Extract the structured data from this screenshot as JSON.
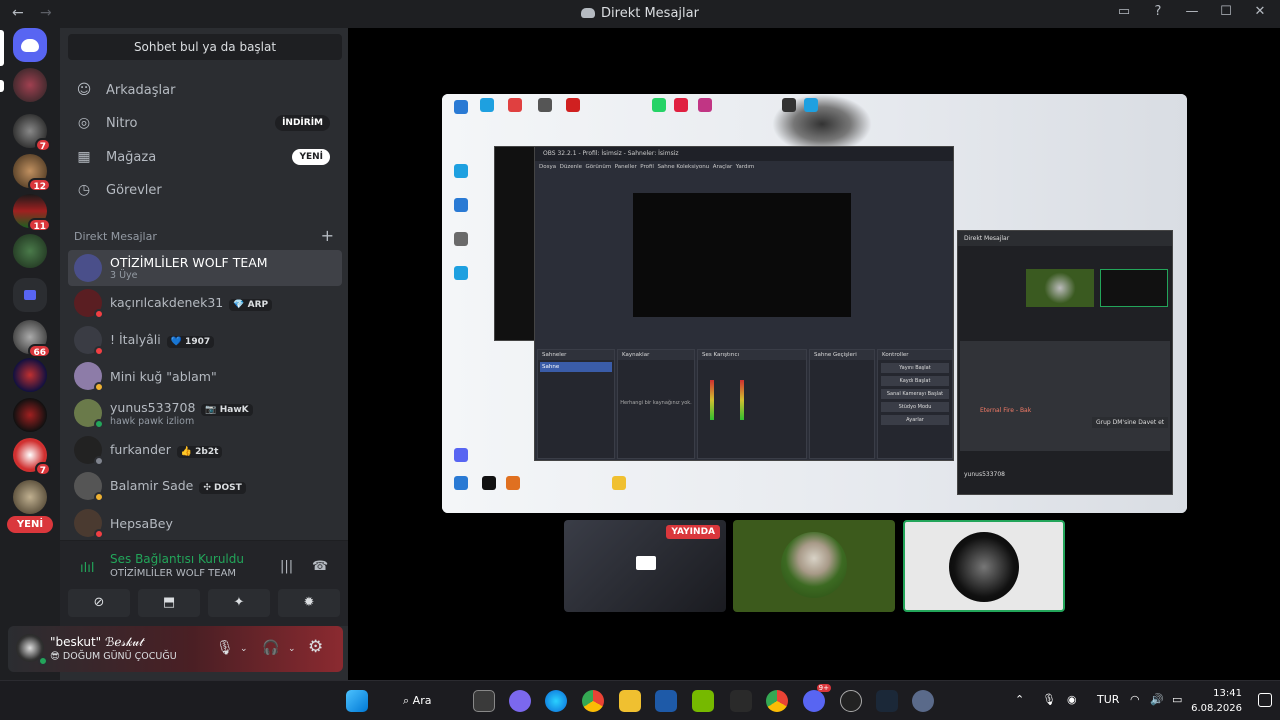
{
  "window": {
    "title": "Direkt Mesajlar",
    "back": "←",
    "forward": "→",
    "controls": {
      "inbox": "▭",
      "help": "?",
      "minimize": "—",
      "maximize": "☐",
      "close": "✕"
    }
  },
  "guilds": {
    "badges": [
      "7",
      "12",
      "11",
      "66",
      "7"
    ],
    "new_label": "YENİ"
  },
  "sidebar": {
    "search_placeholder": "Sohbet bul ya da başlat",
    "nav": [
      {
        "label": "Arkadaşlar",
        "icon": "friends-icon",
        "glyph": "☺"
      },
      {
        "label": "Nitro",
        "icon": "nitro-icon",
        "glyph": "◎",
        "badge": "İNDİRİM"
      },
      {
        "label": "Mağaza",
        "icon": "shop-icon",
        "glyph": "▦",
        "badge": "YENİ"
      },
      {
        "label": "Görevler",
        "icon": "quests-icon",
        "glyph": "◷"
      }
    ],
    "dm_header": "Direkt Mesajlar",
    "dm_add": "+",
    "dms": [
      {
        "name": "OTİZİMLİLER WOLF TEAM",
        "sub": "3 Üye",
        "color": "#4a4f8a",
        "status": ""
      },
      {
        "name": "kaçırılcakdenek31",
        "tag": "💎 ARP",
        "color": "#5a1e22",
        "status": "#f23f43"
      },
      {
        "name": "! İtalyâli",
        "tag": "💙 1907",
        "color": "#3a3c44",
        "status": "#f23f43"
      },
      {
        "name": "Mini kuğ \"ablam\"",
        "color": "#8d7ca8",
        "status": "#f0b232"
      },
      {
        "name": "yunus533708",
        "tag": "📷 HawK",
        "sub": "hawk pawk izliom",
        "color": "#6a7a4a",
        "status": "#23a55a"
      },
      {
        "name": "furkander",
        "tag": "👍 2b2t",
        "color": "#222",
        "status": "#80848e"
      },
      {
        "name": "Balamir Sade",
        "tag": "✣ DOST",
        "color": "#555",
        "status": "#f0b232"
      },
      {
        "name": "HepsaBey",
        "color": "#4a3a30",
        "status": "#f23f43"
      }
    ]
  },
  "voice": {
    "title": "Ses Bağlantısı Kuruldu",
    "channel": "OTİZİMLİLER WOLF TEAM",
    "buttons": [
      "⊘",
      "⬒",
      "✦",
      "✹"
    ]
  },
  "user": {
    "display_name": "\"beskut\" ℬℯ𝓈𝓀𝓊𝓉",
    "status": "😎 DOĞUM GÜNÜ ÇOCUĞU"
  },
  "stream": {
    "obs_title": "OBS 32.2.1 - Profil: İsimsiz - Sahneler: İsimsiz",
    "obs_menu": [
      "Dosya",
      "Düzenle",
      "Görünüm",
      "Paneller",
      "Profil",
      "Sahne Koleksiyonu",
      "Araçlar",
      "Yardım"
    ],
    "obs_docks": [
      "Sahneler",
      "Kaynaklar",
      "Ses Karıştırıcı",
      "Sahne Geçişleri",
      "Kontroller"
    ],
    "obs_controls": [
      "Yayını Başlat",
      "Kaydı Başlat",
      "Sanal Kamerayı Başlat",
      "Stüdyo Modu",
      "Ayarlar"
    ],
    "obs_scene": "Sahne",
    "obs_no_source": "Herhangi bir kaynağınız yok.",
    "dc_title": "Direkt Mesajlar",
    "dc_message": "Eternal Fire - Bak",
    "dc_invite": "Grup DM'sine Davet et",
    "dc_user": "yunus533708"
  },
  "thumbs": {
    "live_label": "YAYINDA"
  },
  "taskbar": {
    "search_label": "Ara",
    "lang": "TUR",
    "time": "13:41",
    "date": "6.08.2026",
    "discord_badge": "9+"
  }
}
